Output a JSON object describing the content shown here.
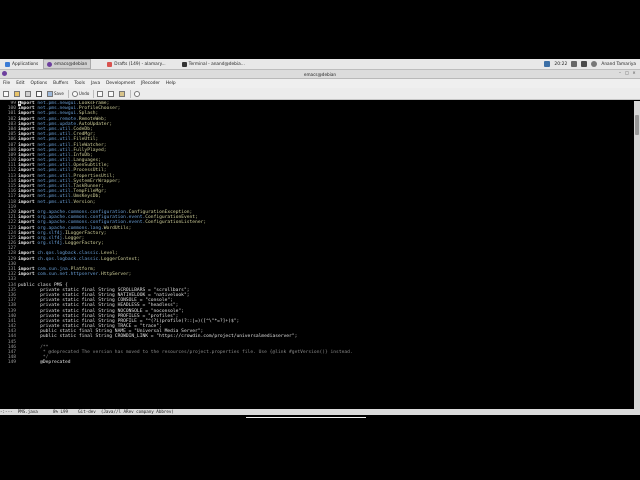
{
  "taskbar": {
    "items": [
      {
        "label": "Applications",
        "color": "#3a7bd5"
      },
      {
        "label": "emacs@debian",
        "color": "#6d3f9e"
      },
      {
        "label": "Drafts (149) - alamary...",
        "color": "#d9534f"
      },
      {
        "label": "Terminal - anand@debia...",
        "color": "#333333"
      }
    ],
    "clock": "20:22",
    "user": "Anand Tamariya"
  },
  "window": {
    "title": "emacs@debian"
  },
  "menu": [
    "File",
    "Edit",
    "Options",
    "Buffers",
    "Tools",
    "Java",
    "Development",
    "JRecoder",
    "Help"
  ],
  "toolbar": {
    "save_label": "Save",
    "undo_label": "Undo"
  },
  "editor": {
    "lines": [
      {
        "n": "99",
        "k": "import",
        "p": "net.pms.newgui.",
        "c": "LooksFrame;",
        "cursor": true
      },
      {
        "n": "100",
        "k": "import",
        "p": "net.pms.newgui.",
        "c": "ProfileChooser;"
      },
      {
        "n": "101",
        "k": "import",
        "p": "net.pms.newgui.",
        "c": "Splash;"
      },
      {
        "n": "102",
        "k": "import",
        "p": "net.pms.remote.",
        "c": "RemoteWeb;"
      },
      {
        "n": "103",
        "k": "import",
        "p": "net.pms.update.",
        "c": "AutoUpdater;"
      },
      {
        "n": "104",
        "k": "import",
        "p": "net.pms.util.",
        "c": "CodeDb;"
      },
      {
        "n": "105",
        "k": "import",
        "p": "net.pms.util.",
        "c": "CredMgr;"
      },
      {
        "n": "106",
        "k": "import",
        "p": "net.pms.util.",
        "c": "FileUtil;"
      },
      {
        "n": "107",
        "k": "import",
        "p": "net.pms.util.",
        "c": "FileWatcher;"
      },
      {
        "n": "108",
        "k": "import",
        "p": "net.pms.util.",
        "c": "FullyPlayed;"
      },
      {
        "n": "109",
        "k": "import",
        "p": "net.pms.util.",
        "c": "InfoDb;"
      },
      {
        "n": "110",
        "k": "import",
        "p": "net.pms.util.",
        "c": "Languages;"
      },
      {
        "n": "111",
        "k": "import",
        "p": "net.pms.util.",
        "c": "OpenSubtitle;"
      },
      {
        "n": "112",
        "k": "import",
        "p": "net.pms.util.",
        "c": "ProcessUtil;"
      },
      {
        "n": "113",
        "k": "import",
        "p": "net.pms.util.",
        "c": "PropertiesUtil;"
      },
      {
        "n": "114",
        "k": "import",
        "p": "net.pms.util.",
        "c": "SystemErrWrapper;"
      },
      {
        "n": "115",
        "k": "import",
        "p": "net.pms.util.",
        "c": "TaskRunner;"
      },
      {
        "n": "116",
        "k": "import",
        "p": "net.pms.util.",
        "c": "TempFileMgr;"
      },
      {
        "n": "117",
        "k": "import",
        "p": "net.pms.util.",
        "c": "UmsKeysDb;"
      },
      {
        "n": "118",
        "k": "import",
        "p": "net.pms.util.",
        "c": "Version;"
      },
      {
        "n": "119",
        "k": "",
        "p": "",
        "c": ""
      },
      {
        "n": "120",
        "k": "import",
        "p": "org.apache.commons.configuration.",
        "c": "ConfigurationException;"
      },
      {
        "n": "121",
        "k": "import",
        "p": "org.apache.commons.configuration.event.",
        "c": "ConfigurationEvent;"
      },
      {
        "n": "122",
        "k": "import",
        "p": "org.apache.commons.configuration.event.",
        "c": "ConfigurationListener;"
      },
      {
        "n": "123",
        "k": "import",
        "p": "org.apache.commons.lang.",
        "c": "WordUtils;"
      },
      {
        "n": "124",
        "k": "import",
        "p": "org.slf4j.",
        "c": "ILoggerFactory;"
      },
      {
        "n": "125",
        "k": "import",
        "p": "org.slf4j.",
        "c": "Logger;"
      },
      {
        "n": "126",
        "k": "import",
        "p": "org.slf4j.",
        "c": "LoggerFactory;"
      },
      {
        "n": "127",
        "k": "",
        "p": "",
        "c": ""
      },
      {
        "n": "128",
        "k": "import",
        "p": "ch.qos.logback.classic.",
        "c": "Level;"
      },
      {
        "n": "129",
        "k": "import",
        "p": "ch.qos.logback.classic.",
        "c": "LoggerContext;"
      },
      {
        "n": "130",
        "k": "",
        "p": "",
        "c": ""
      },
      {
        "n": "131",
        "k": "import",
        "p": "com.sun.jna.",
        "c": "Platform;"
      },
      {
        "n": "132",
        "k": "import",
        "p": "com.sun.net.httpserver.",
        "c": "HttpServer;"
      },
      {
        "n": "133",
        "k": "",
        "p": "",
        "c": ""
      },
      {
        "n": "134",
        "t": "public class PMS {"
      },
      {
        "n": "135",
        "t": "        private static final String SCROLLBARS = \"scrollbars\";"
      },
      {
        "n": "136",
        "t": "        private static final String NATIVELOOK = \"nativelook\";"
      },
      {
        "n": "137",
        "t": "        private static final String CONSOLE = \"console\";"
      },
      {
        "n": "138",
        "t": "        private static final String HEADLESS = \"headless\";"
      },
      {
        "n": "139",
        "t": "        private static final String NOCONSOLE = \"noconsole\";"
      },
      {
        "n": "140",
        "t": "        private static final String PROFILES = \"profiles\";"
      },
      {
        "n": "141",
        "t": "        private static final String PROFILE = \"^(?i)profile(?::|=)([^\\\"*=?]+)$\";"
      },
      {
        "n": "142",
        "t": "        private static final String TRACE = \"trace\";"
      },
      {
        "n": "143",
        "t": "        public static final String NAME = \"Universal Media Server\";"
      },
      {
        "n": "144",
        "t": "        public static final String CROWDIN_LINK = \"https://crowdin.com/project/universalmediaserver\";"
      },
      {
        "n": "145",
        "t": ""
      },
      {
        "n": "146",
        "t": "        /**",
        "cm": true
      },
      {
        "n": "147",
        "t": "         * @deprecated The version has moved to the resources/project.properties file. Use {@link #getVersion()} instead.",
        "cm": true
      },
      {
        "n": "148",
        "t": "         */",
        "cm": true
      },
      {
        "n": "149",
        "t": "        @Deprecated"
      }
    ]
  },
  "modeline": "-:---  PMS.java      8% L99    Git-dev  (Java//l ARev company Abbrev)"
}
